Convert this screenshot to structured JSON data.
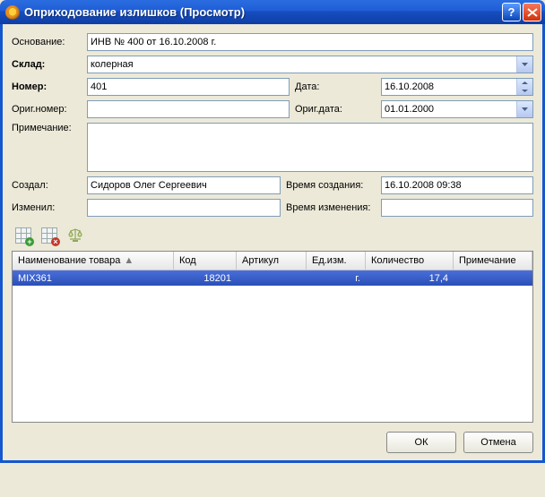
{
  "window": {
    "title": "Оприходование излишков (Просмотр)"
  },
  "labels": {
    "basis": "Основание:",
    "warehouse": "Склад:",
    "number": "Номер:",
    "date": "Дата:",
    "orig_number": "Ориг.номер:",
    "orig_date": "Ориг.дата:",
    "note": "Примечание:",
    "created_by": "Создал:",
    "created_at": "Время создания:",
    "changed_by": "Изменил:",
    "changed_at": "Время изменения:"
  },
  "fields": {
    "basis": "ИНВ № 400 от 16.10.2008 г.",
    "warehouse": "колерная",
    "number": "401",
    "date": "16.10.2008",
    "orig_number": "",
    "orig_date": "01.01.2000",
    "note": "",
    "created_by": "Сидоров Олег Сергеевич",
    "created_at": "16.10.2008 09:38",
    "changed_by": "",
    "changed_at": ""
  },
  "table": {
    "columns": {
      "name": "Наименование товара",
      "code": "Код",
      "sku": "Артикул",
      "unit": "Ед.изм.",
      "qty": "Количество",
      "note": "Примечание"
    },
    "rows": [
      {
        "name": "MIX361",
        "code": "18201",
        "sku": "",
        "unit": "г.",
        "qty": "17,4",
        "note": ""
      }
    ]
  },
  "buttons": {
    "ok": "ОК",
    "cancel": "Отмена"
  }
}
